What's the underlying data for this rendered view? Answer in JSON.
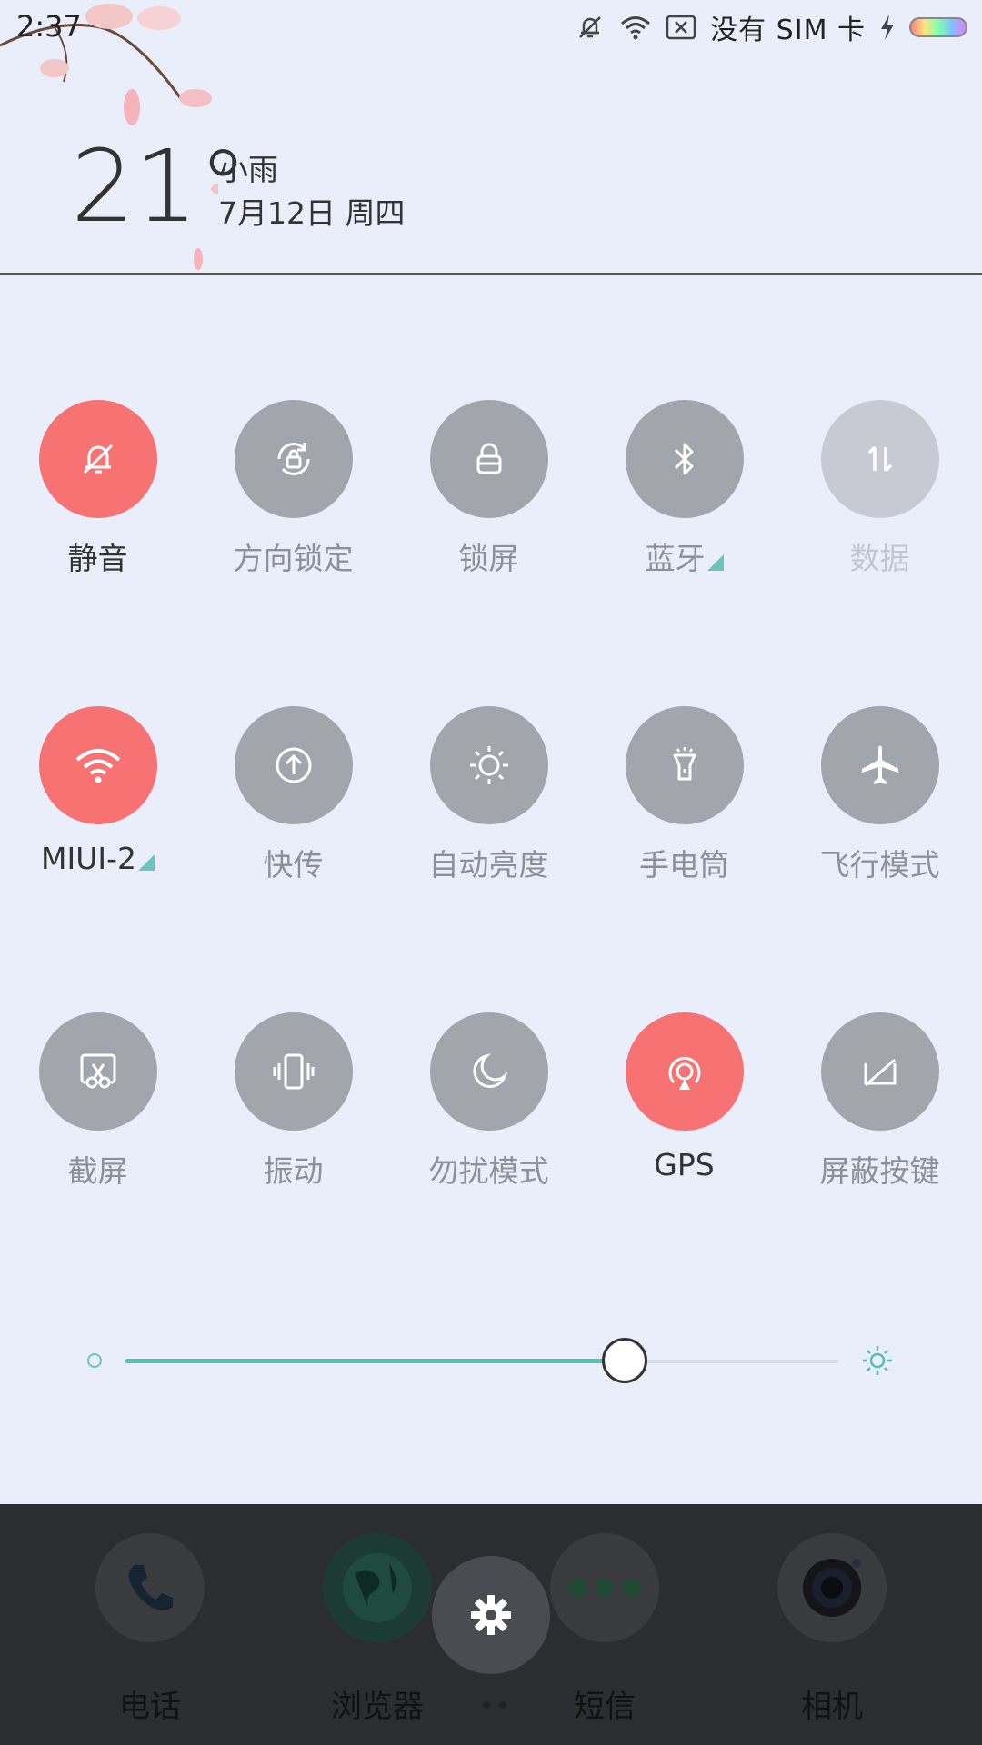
{
  "status_bar": {
    "time": "2:37",
    "carrier": "没有 SIM 卡",
    "icons": [
      "bell-muted-icon",
      "wifi-icon",
      "no-sim-icon",
      "charging-icon",
      "battery-icon"
    ]
  },
  "weather": {
    "temperature": "21°",
    "condition": "小雨",
    "date": "7月12日 周四"
  },
  "quick_tiles": [
    {
      "label": "静音",
      "icon": "bell-muted-icon",
      "state": "on"
    },
    {
      "label": "方向锁定",
      "icon": "rotation-lock-icon",
      "state": "off"
    },
    {
      "label": "锁屏",
      "icon": "lock-icon",
      "state": "off"
    },
    {
      "label": "蓝牙",
      "icon": "bluetooth-icon",
      "state": "off",
      "expandable": true
    },
    {
      "label": "数据",
      "icon": "mobile-data-icon",
      "state": "disabled"
    },
    {
      "label": "MIUI-2",
      "icon": "wifi-icon",
      "state": "on",
      "expandable": true
    },
    {
      "label": "快传",
      "icon": "share-upload-icon",
      "state": "off"
    },
    {
      "label": "自动亮度",
      "icon": "sun-icon",
      "state": "off"
    },
    {
      "label": "手电筒",
      "icon": "flashlight-icon",
      "state": "off"
    },
    {
      "label": "飞行模式",
      "icon": "airplane-icon",
      "state": "off"
    },
    {
      "label": "截屏",
      "icon": "screenshot-icon",
      "state": "off"
    },
    {
      "label": "振动",
      "icon": "vibrate-icon",
      "state": "off"
    },
    {
      "label": "勿扰模式",
      "icon": "moon-icon",
      "state": "off"
    },
    {
      "label": "GPS",
      "icon": "gps-icon",
      "state": "on"
    },
    {
      "label": "屏蔽按键",
      "icon": "block-keys-icon",
      "state": "off"
    }
  ],
  "brightness": {
    "level": 0.7
  },
  "dock": {
    "apps": [
      {
        "label": "电话",
        "icon": "phone-icon"
      },
      {
        "label": "浏览器",
        "icon": "browser-icon"
      },
      {
        "label": "短信",
        "icon": "messages-icon"
      },
      {
        "label": "相机",
        "icon": "camera-icon"
      }
    ],
    "settings_icon": "gear-icon"
  },
  "colors": {
    "active": "#f77272",
    "inactive": "#a3a5ac",
    "disabled": "#c8cad3",
    "accent": "#54c0b5",
    "panel": "#eaeefa"
  }
}
